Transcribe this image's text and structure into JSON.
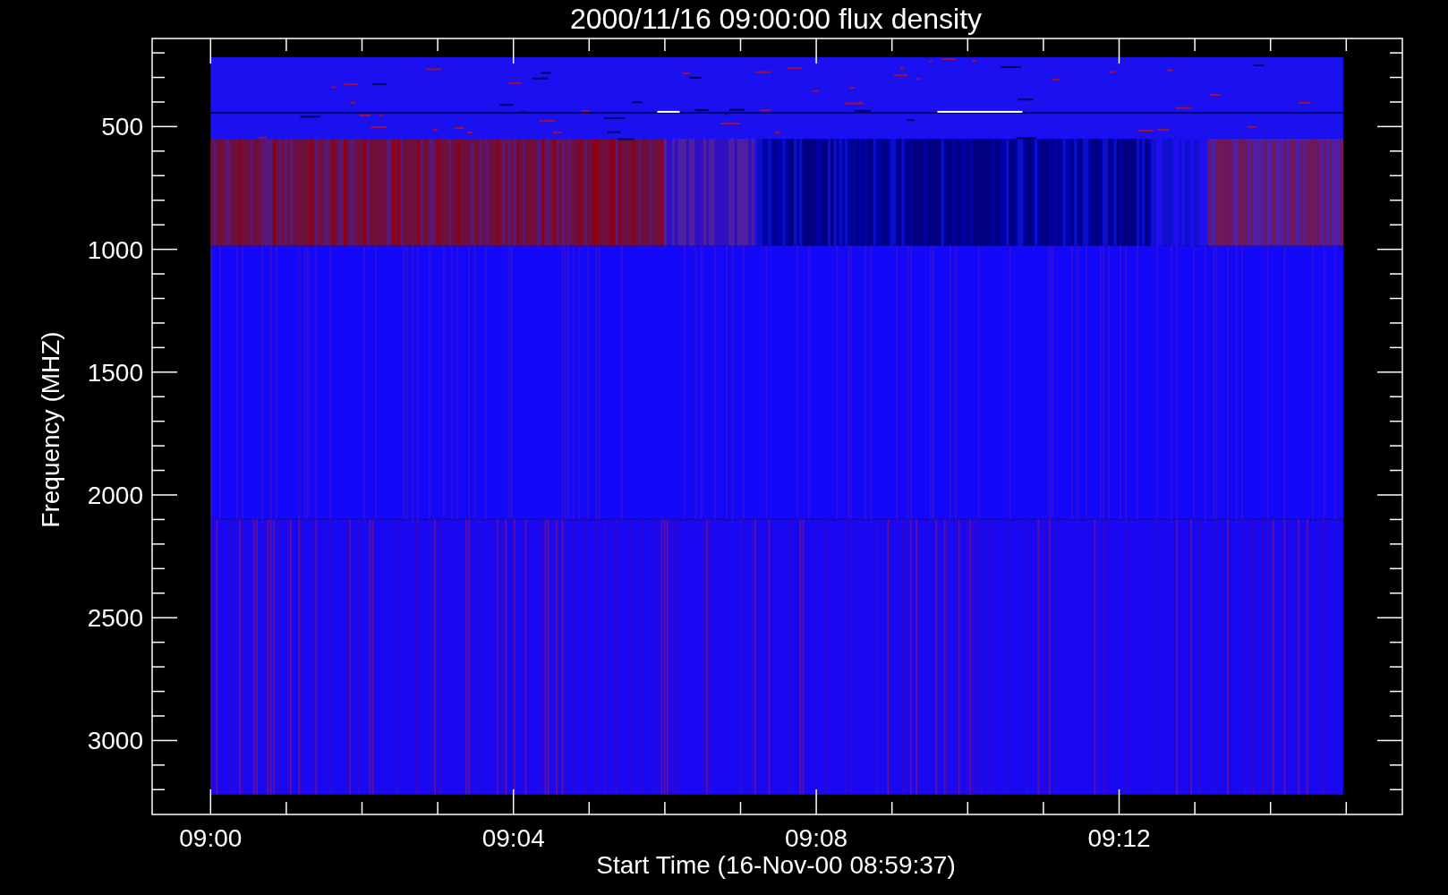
{
  "plot": {
    "title": "2000/11/16 09:00:00 flux density",
    "xlabel": "Start Time (16-Nov-00 08:59:37)",
    "ylabel": "Frequency (MHZ)",
    "yticks": [
      "500",
      "1000",
      "1500",
      "2000",
      "2500",
      "3000"
    ],
    "xticks": [
      "09:00",
      "09:04",
      "09:08",
      "09:12"
    ]
  }
}
